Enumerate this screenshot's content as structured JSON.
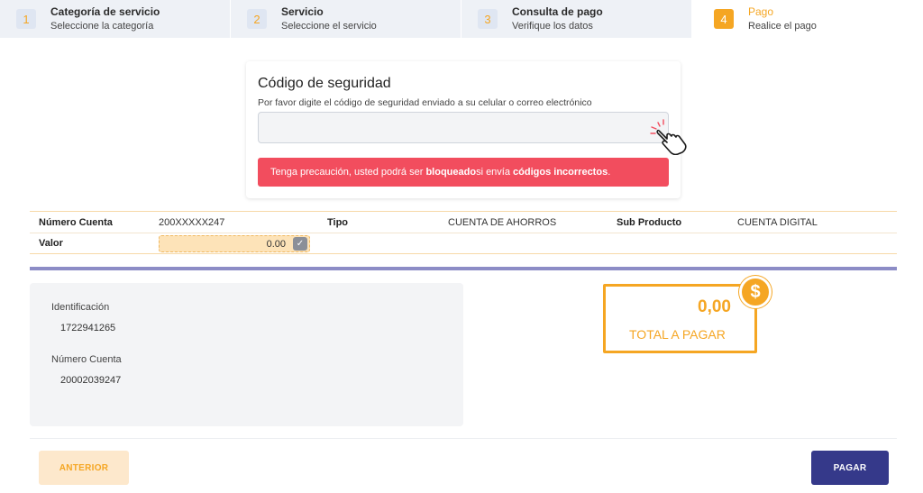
{
  "stepper": [
    {
      "num": "1",
      "title": "Categoría de servicio",
      "sub": "Seleccione la categoría"
    },
    {
      "num": "2",
      "title": "Servicio",
      "sub": "Seleccione el servicio"
    },
    {
      "num": "3",
      "title": "Consulta de pago",
      "sub": "Verifique los datos"
    },
    {
      "num": "4",
      "title": "Pago",
      "sub": "Realice el pago"
    }
  ],
  "security": {
    "title": "Código de seguridad",
    "description": "Por favor digite el código de seguridad enviado a su celular o correo electrónico",
    "input_value": "",
    "warning_pre": "Tenga precaución, usted podrá ser ",
    "warning_b1": "bloqueado",
    "warning_mid": " si envía ",
    "warning_b2": "códigos incorrectos",
    "warning_end": "."
  },
  "account": {
    "numero_cuenta_label": "Número Cuenta",
    "numero_cuenta_value": "200XXXXX247",
    "tipo_label": "Tipo",
    "tipo_value": "CUENTA DE AHORROS",
    "subproducto_label": "Sub Producto",
    "subproducto_value": "CUENTA DIGITAL",
    "valor_label": "Valor",
    "valor_value": "0.00",
    "valor_check": "✓"
  },
  "details": {
    "identificacion_label": "Identificación",
    "identificacion_value": "1722941265",
    "numero_cuenta_label": "Número Cuenta",
    "numero_cuenta_value": "20002039247"
  },
  "total": {
    "amount": "0,00",
    "label": "TOTAL A PAGAR",
    "symbol": "$"
  },
  "buttons": {
    "prev": "ANTERIOR",
    "pay": "PAGAR"
  },
  "colors": {
    "accent": "#f5a623",
    "danger": "#f24d5e",
    "primary": "#35398a"
  },
  "icons": {
    "pointer": "pointing-hand-icon",
    "dollar": "dollar-coin-icon",
    "check": "check-icon"
  }
}
